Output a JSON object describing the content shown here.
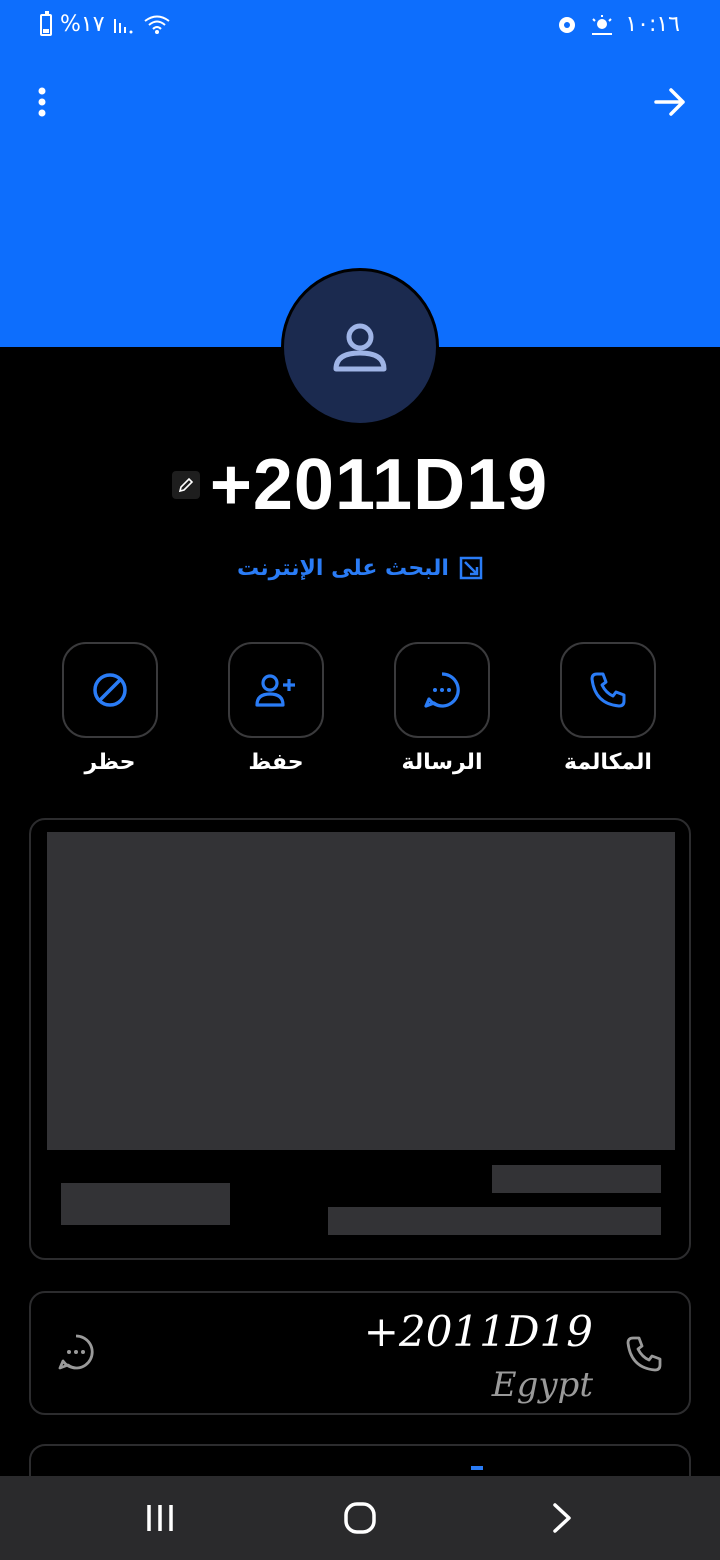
{
  "status_bar": {
    "battery_text": "%١٧",
    "time": "١٠:١٦"
  },
  "contact": {
    "number": "+2011D19",
    "web_search_label": "البحث على الإنترنت"
  },
  "actions": [
    {
      "label": "حظر",
      "icon": "block-icon"
    },
    {
      "label": "حفظ",
      "icon": "add-contact-icon"
    },
    {
      "label": "الرسالة",
      "icon": "message-icon"
    },
    {
      "label": "المكالمة",
      "icon": "call-icon"
    }
  ],
  "phone_entry": {
    "number": "+2011D19",
    "country": "Egypt"
  },
  "colors": {
    "header_blue": "#0d6efd",
    "accent": "#2a7cf6",
    "avatar_bg": "#1b2a4f"
  }
}
